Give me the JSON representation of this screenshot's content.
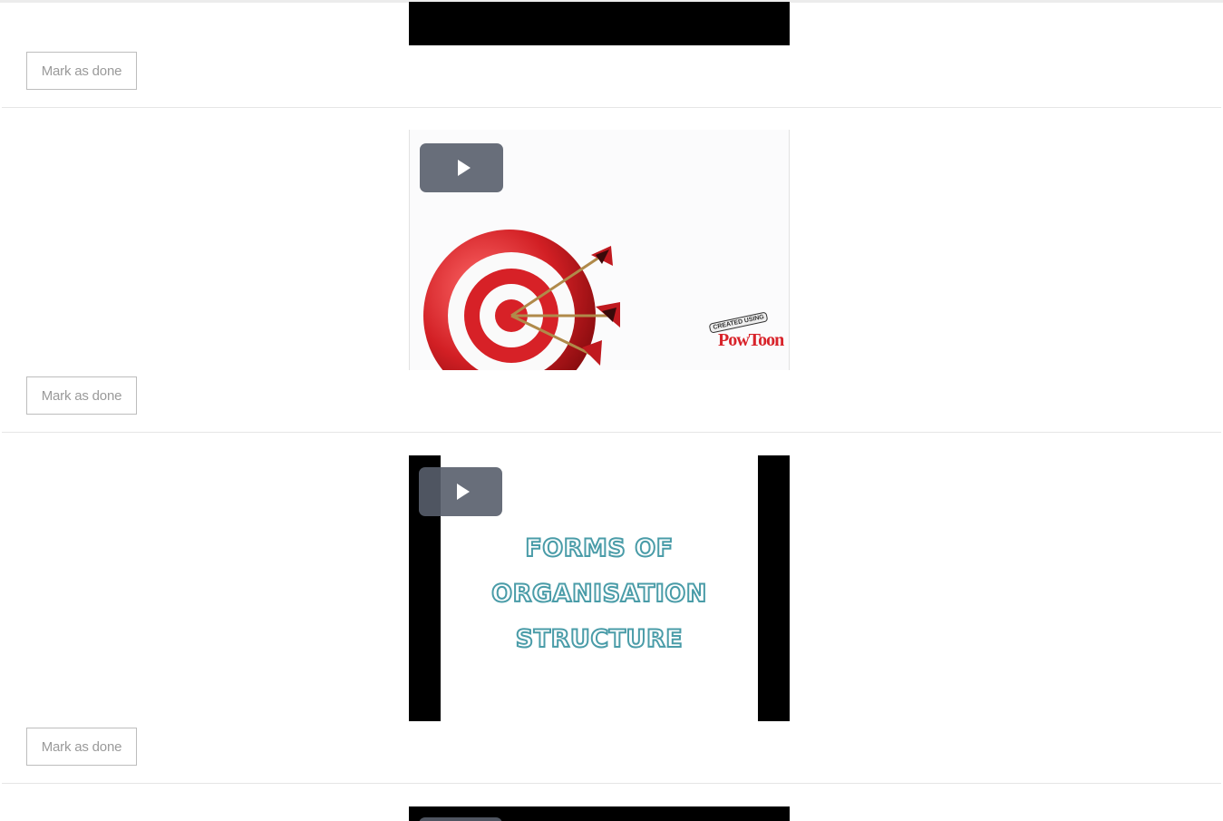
{
  "lessons": [
    {
      "done_label": "Mark as done"
    },
    {
      "done_label": "Mark as done",
      "video": {
        "play_icon": "play-icon",
        "logo_small": "CREATED USING",
        "logo_main": "PowToon"
      }
    },
    {
      "done_label": "Mark as done",
      "video": {
        "play_icon": "play-icon",
        "title_lines": [
          "FORMS OF",
          "ORGANISATION",
          "STRUCTURE"
        ]
      }
    },
    {
      "video": {
        "play_icon": "play-icon"
      }
    }
  ],
  "colors": {
    "button_border": "#bdbdbd",
    "button_text": "#9a9a9a",
    "play_button_bg": "#585e6c",
    "title_outline": "#4a9ca8",
    "divider": "#e6e6e6"
  }
}
